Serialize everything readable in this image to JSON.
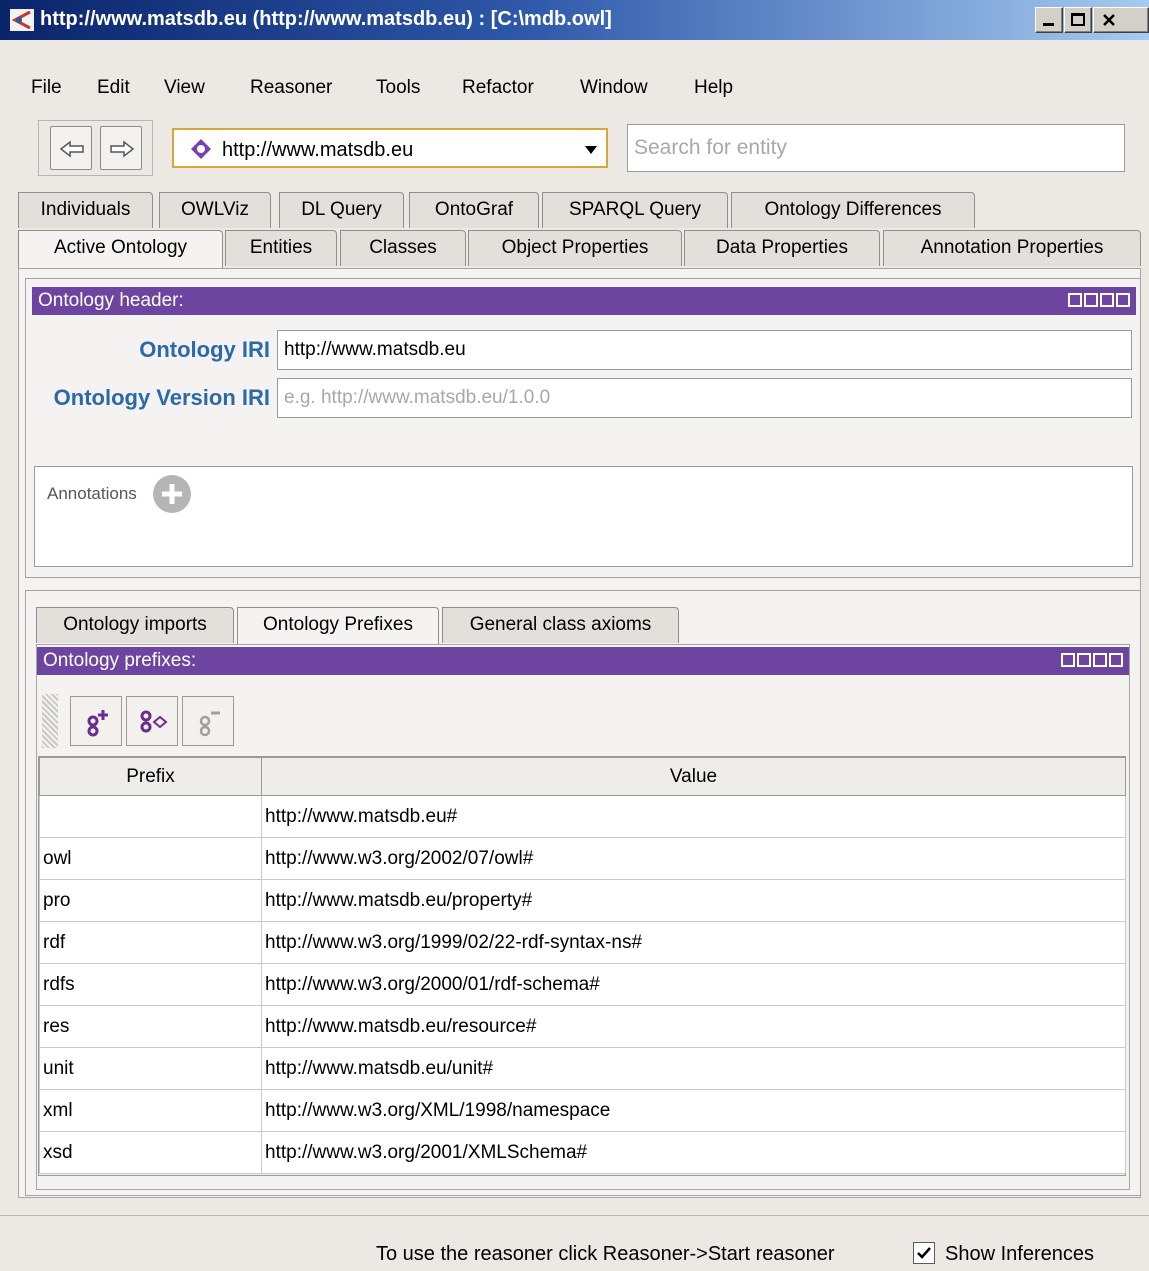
{
  "window": {
    "title": "http://www.matsdb.eu (http://www.matsdb.eu) : [C:\\mdb.owl]",
    "accent_color": "#6e44a1"
  },
  "menu": [
    "File",
    "Edit",
    "View",
    "Reasoner",
    "Tools",
    "Refactor",
    "Window",
    "Help"
  ],
  "toolbar": {
    "ontology_selected": "http://www.matsdb.eu",
    "search_placeholder": "Search for entity"
  },
  "tabs_row1": [
    "Individuals",
    "OWLViz",
    "DL Query",
    "OntoGraf",
    "SPARQL Query",
    "Ontology Differences"
  ],
  "tabs_row2": [
    "Active Ontology",
    "Entities",
    "Classes",
    "Object Properties",
    "Data Properties",
    "Annotation Properties"
  ],
  "header_panel": {
    "title": "Ontology header:",
    "iri_label": "Ontology IRI",
    "iri_value": "http://www.matsdb.eu",
    "version_label": "Ontology Version IRI",
    "version_placeholder": "e.g. http://www.matsdb.eu/1.0.0",
    "annotations_label": "Annotations"
  },
  "subtabs": [
    "Ontology imports",
    "Ontology Prefixes",
    "General class axioms"
  ],
  "prefixes_panel": {
    "title": "Ontology prefixes:",
    "columns": [
      "Prefix",
      "Value"
    ],
    "rows": [
      {
        "prefix": "",
        "value": "http://www.matsdb.eu#"
      },
      {
        "prefix": "owl",
        "value": "http://www.w3.org/2002/07/owl#"
      },
      {
        "prefix": "pro",
        "value": "http://www.matsdb.eu/property#"
      },
      {
        "prefix": "rdf",
        "value": "http://www.w3.org/1999/02/22-rdf-syntax-ns#"
      },
      {
        "prefix": "rdfs",
        "value": "http://www.w3.org/2000/01/rdf-schema#"
      },
      {
        "prefix": "res",
        "value": "http://www.matsdb.eu/resource#"
      },
      {
        "prefix": "unit",
        "value": "http://www.matsdb.eu/unit#"
      },
      {
        "prefix": "xml",
        "value": "http://www.w3.org/XML/1998/namespace"
      },
      {
        "prefix": "xsd",
        "value": "http://www.w3.org/2001/XMLSchema#"
      }
    ]
  },
  "status": {
    "message": "To use the reasoner click Reasoner->Start reasoner",
    "show_inferences_label": "Show Inferences",
    "show_inferences_checked": true
  }
}
